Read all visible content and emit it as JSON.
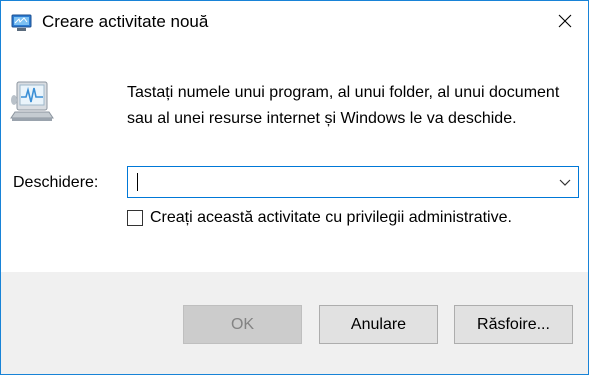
{
  "window": {
    "title": "Creare activitate nouă",
    "title_icon": "run-dialog-icon",
    "close_icon": "close-icon",
    "accent_color": "#1883d7"
  },
  "content": {
    "icon": "run-program-icon",
    "description": "Tastați numele unui program, al unui folder, al unui document sau al unei resurse internet și Windows le va deschide.",
    "open_label": "Deschidere:",
    "open_value": "",
    "dropdown_icon": "chevron-down-icon",
    "admin_checkbox_label": "Creați această activitate cu privilegii administrative.",
    "admin_checkbox_checked": false
  },
  "footer": {
    "ok_label": "OK",
    "ok_enabled": false,
    "cancel_label": "Anulare",
    "browse_label": "Răsfoire..."
  }
}
